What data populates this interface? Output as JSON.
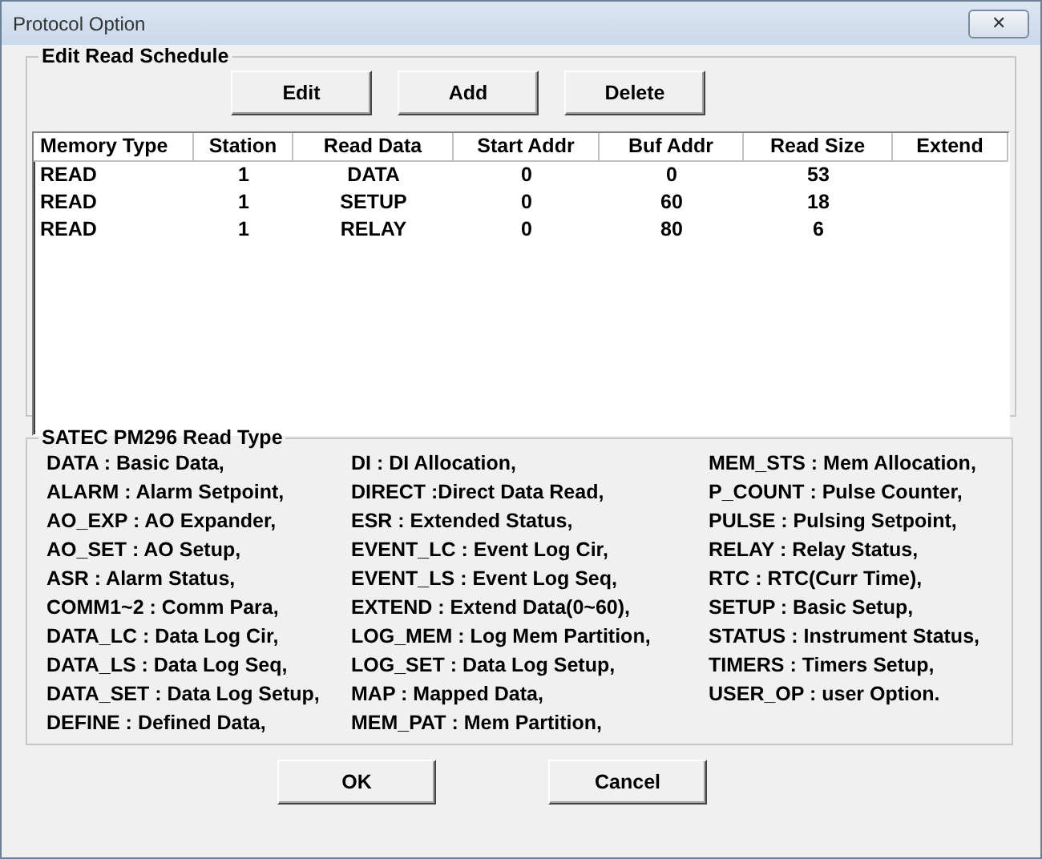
{
  "window": {
    "title": "Protocol Option",
    "close": "✕"
  },
  "schedule": {
    "title": "Edit Read Schedule",
    "buttons": [
      "Edit",
      "Add",
      "Delete"
    ],
    "columns": [
      "Memory Type",
      "Station",
      "Read Data",
      "Start Addr",
      "Buf Addr",
      "Read Size",
      "Extend"
    ],
    "rows": [
      [
        "READ",
        "1",
        "DATA",
        "0",
        "0",
        "53"
      ],
      [
        "READ",
        "1",
        "SETUP",
        "0",
        "60",
        "18"
      ],
      [
        "READ",
        "1",
        "RELAY",
        "0",
        "80",
        "6"
      ]
    ]
  },
  "read_types": {
    "title": "SATEC PM296 Read Type",
    "columns": [
      [
        "DATA : Basic Data,",
        "ALARM : Alarm Setpoint,",
        "AO_EXP : AO Expander,",
        "AO_SET : AO Setup,",
        "ASR : Alarm Status,",
        "COMM1~2 : Comm Para,",
        "DATA_LC : Data Log Cir,",
        "DATA_LS : Data Log Seq,",
        "DATA_SET : Data Log Setup,",
        "DEFINE : Defined Data,"
      ],
      [
        "DI : DI Allocation,",
        "DIRECT :Direct Data Read,",
        "ESR : Extended Status,",
        "EVENT_LC : Event Log Cir,",
        "EVENT_LS : Event Log Seq,",
        "EXTEND : Extend Data(0~60),",
        "LOG_MEM : Log Mem Partition,",
        "LOG_SET : Data Log Setup,",
        "MAP : Mapped Data,",
        "MEM_PAT : Mem Partition,"
      ],
      [
        "MEM_STS : Mem Allocation,",
        "P_COUNT : Pulse Counter,",
        "PULSE : Pulsing Setpoint,",
        "RELAY : Relay Status,",
        "RTC : RTC(Curr Time),",
        "SETUP : Basic Setup,",
        "STATUS : Instrument Status,",
        "TIMERS : Timers Setup,",
        "USER_OP : user Option."
      ]
    ]
  },
  "buttons": [
    "OK",
    "Cancel"
  ]
}
